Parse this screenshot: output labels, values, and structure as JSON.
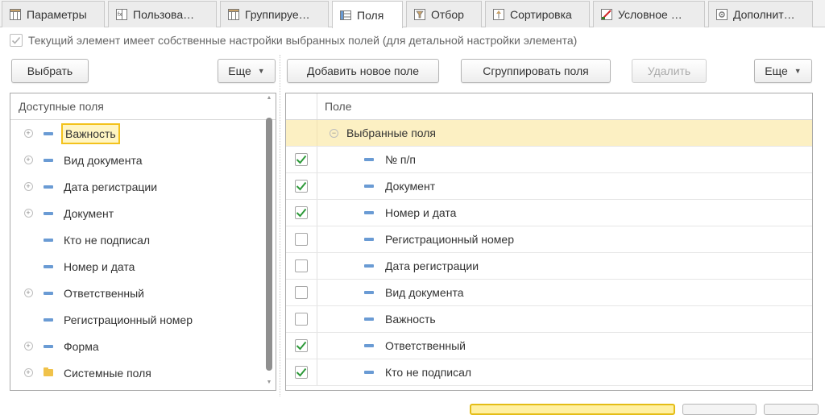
{
  "tabs": [
    {
      "label": "Параметры",
      "icon": "table-icon"
    },
    {
      "label": "Пользова…",
      "icon": "user-fields-icon"
    },
    {
      "label": "Группируе…",
      "icon": "grouping-icon"
    },
    {
      "label": "Поля",
      "icon": "fields-icon"
    },
    {
      "label": "Отбор",
      "icon": "filter-icon"
    },
    {
      "label": "Сортировка",
      "icon": "sort-icon"
    },
    {
      "label": "Условное …",
      "icon": "conditional-format-icon"
    },
    {
      "label": "Дополнит…",
      "icon": "additional-settings-icon"
    }
  ],
  "active_tab": "Поля",
  "own_settings_option": {
    "label": "Текущий элемент имеет собственные настройки выбранных полей (для детальной настройки элемента)",
    "checked": true
  },
  "left": {
    "select_button": "Выбрать",
    "more_button": "Еще",
    "header": "Доступные поля",
    "items": [
      {
        "label": "Важность",
        "expandable": true,
        "icon": "field-icon",
        "current": true
      },
      {
        "label": "Вид документа",
        "expandable": true,
        "icon": "field-icon"
      },
      {
        "label": "Дата регистрации",
        "expandable": true,
        "icon": "field-icon"
      },
      {
        "label": "Документ",
        "expandable": true,
        "icon": "field-icon"
      },
      {
        "label": "Кто не подписал",
        "expandable": false,
        "icon": "field-icon"
      },
      {
        "label": "Номер и дата",
        "expandable": false,
        "icon": "field-icon"
      },
      {
        "label": "Ответственный",
        "expandable": true,
        "icon": "field-icon"
      },
      {
        "label": "Регистрационный номер",
        "expandable": false,
        "icon": "field-icon"
      },
      {
        "label": "Форма",
        "expandable": true,
        "icon": "field-icon"
      },
      {
        "label": "Системные поля",
        "expandable": true,
        "icon": "folder-icon"
      }
    ]
  },
  "right": {
    "add_button": "Добавить новое поле",
    "group_button": "Сгруппировать поля",
    "delete_button": "Удалить",
    "more_button": "Еще",
    "header": "Поле",
    "group_label": "Выбранные поля",
    "fields": [
      {
        "label": "№ п/п",
        "checked": true
      },
      {
        "label": "Документ",
        "checked": true
      },
      {
        "label": "Номер и дата",
        "checked": true
      },
      {
        "label": "Регистрационный номер",
        "checked": false
      },
      {
        "label": "Дата регистрации",
        "checked": false
      },
      {
        "label": "Вид документа",
        "checked": false
      },
      {
        "label": "Важность",
        "checked": false
      },
      {
        "label": "Ответственный",
        "checked": true
      },
      {
        "label": "Кто не подписал",
        "checked": true
      }
    ]
  },
  "colors": {
    "check_green": "#2e9a3a",
    "current_highlight": "#f3c21c",
    "group_row": "#fcf0c3",
    "field_icon": "#6a9bd4"
  }
}
